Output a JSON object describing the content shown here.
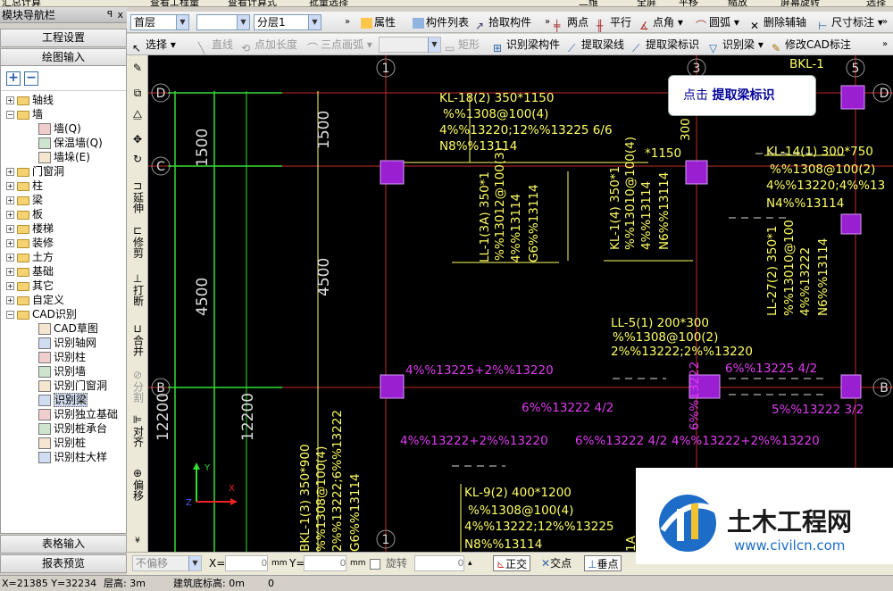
{
  "top_strip": [
    "汇总计算",
    "查看工程量",
    "查看计算式",
    "批量选择",
    "二维",
    "全屏",
    "平移",
    "缩放",
    "屏幕旋转",
    "选择"
  ],
  "nav_panel": {
    "title": "模块导航栏",
    "pin": "ꟼ",
    "close": "x",
    "btn_project": "工程设置",
    "btn_draw": "绘图输入",
    "btn_table": "表格输入",
    "btn_report": "报表预览",
    "tree": [
      {
        "label": "轴线",
        "level": 0,
        "exp": "+"
      },
      {
        "label": "墙",
        "level": 0,
        "exp": "-"
      },
      {
        "label": "墙(Q)",
        "level": 1
      },
      {
        "label": "保温墙(Q)",
        "level": 1
      },
      {
        "label": "墙垛(E)",
        "level": 1
      },
      {
        "label": "门窗洞",
        "level": 0,
        "exp": "+"
      },
      {
        "label": "柱",
        "level": 0,
        "exp": "+"
      },
      {
        "label": "梁",
        "level": 0,
        "exp": "+"
      },
      {
        "label": "板",
        "level": 0,
        "exp": "+"
      },
      {
        "label": "楼梯",
        "level": 0,
        "exp": "+"
      },
      {
        "label": "装修",
        "level": 0,
        "exp": "+"
      },
      {
        "label": "土方",
        "level": 0,
        "exp": "+"
      },
      {
        "label": "基础",
        "level": 0,
        "exp": "+"
      },
      {
        "label": "其它",
        "level": 0,
        "exp": "+"
      },
      {
        "label": "自定义",
        "level": 0,
        "exp": "+"
      },
      {
        "label": "CAD识别",
        "level": 0,
        "exp": "-"
      },
      {
        "label": "CAD草图",
        "level": 1
      },
      {
        "label": "识别轴网",
        "level": 1
      },
      {
        "label": "识别柱",
        "level": 1
      },
      {
        "label": "识别墙",
        "level": 1
      },
      {
        "label": "识别门窗洞",
        "level": 1
      },
      {
        "label": "识别梁",
        "level": 1,
        "selected": true
      },
      {
        "label": "识别独立基础",
        "level": 1
      },
      {
        "label": "识别桩承台",
        "level": 1
      },
      {
        "label": "识别桩",
        "level": 1
      },
      {
        "label": "识别柱大样",
        "level": 1
      }
    ]
  },
  "toolbar1": {
    "floor": "首层",
    "floor2": "",
    "layer": "分层1",
    "props": "属性",
    "comp_list": "构件列表",
    "pick": "拾取构件",
    "two_points": "两点",
    "parallel": "平行",
    "point_angle": "点角",
    "arc": "圆弧",
    "del_aux": "删除辅轴",
    "dim": "尺寸标注"
  },
  "toolbar2": {
    "select": "选择",
    "line": "直线",
    "point_len": "点加长度",
    "three_arc": "三点画弧",
    "rect": "矩形",
    "recog_beam_comp": "识别梁构件",
    "extract_beam_line": "提取梁线",
    "extract_beam_label": "提取梁标识",
    "recog_beam": "识别梁",
    "modify_cad_label": "修改CAD标注"
  },
  "vtoolbar": {
    "extend": "延伸",
    "trim": "修剪",
    "break": "打断",
    "merge": "合并",
    "split": "分割",
    "align": "对齐",
    "offset": "偏移"
  },
  "canvas": {
    "axes": {
      "top": [
        "1",
        "3",
        "5"
      ],
      "side": [
        "D",
        "C",
        "B"
      ],
      "bottom": [
        "1"
      ]
    },
    "dims": {
      "d1": "1500",
      "d2": "4500",
      "d3": "12200",
      "d4": "1500",
      "d5": "4500",
      "d6": "12200"
    },
    "labels": [
      "KL-18(2) 350*1150",
      "%%1308@100(4)",
      "4%%13220;12%%13225 6/6",
      "N8%%13114",
      "LL-1(3A) 350*1",
      "%%13012@100(3)",
      "4%%13114",
      "G6%%13114",
      "KL-1(4) 350*1",
      "%%13010@100(4)",
      "4%%13114",
      "N6%%13114",
      "*1150",
      "KL-14(1) 300*750",
      "%%1308@100(2)",
      "4%%13220;4%%13",
      "N4%%13114",
      "LL-27(2) 350*1",
      "%%13010@100",
      "4%%13222",
      "N6%%13114",
      "LL-5(1) 200*300",
      "%%1308@100(2)",
      "2%%13222;2%%13220",
      "KL-9(2) 400*1200",
      "%%1308@100(4)",
      "4%%13222;12%%13225",
      "N8%%13114",
      "BKL-1(3) 350*900",
      "%%1308@100(4)",
      "2%%13222;6%%13222",
      "G6%%13114",
      "BKL-1",
      "300",
      "1A"
    ],
    "magenta": [
      "4%%13225+2%%13220",
      "6%%13222 4/2",
      "4%%13222+2%%13220",
      "6%%13222 4/2",
      "4%%13222+2%%13220",
      "6%%13225 4/2",
      "5%%13222 3/2",
      "6%%13222"
    ]
  },
  "tooltip": {
    "prefix": "点击",
    "action": "提取梁标识"
  },
  "bottom_bar": {
    "mode": "不偏移",
    "x_label": "X=",
    "x_val": "0",
    "unit1": "mm",
    "y_label": "Y=",
    "y_val": "0",
    "unit2": "mm",
    "rotate": "旋转",
    "rot_val": "0",
    "ortho": "正交",
    "intersect": "交点",
    "perp": "垂点"
  },
  "status": {
    "coords": "X=21385 Y=32234",
    "floor_h": "层高: 3m",
    "base_h": "建筑底标高: 0m",
    "num": "0"
  },
  "watermark": {
    "name": "土木工程网",
    "url": "www.civilcn.com"
  }
}
